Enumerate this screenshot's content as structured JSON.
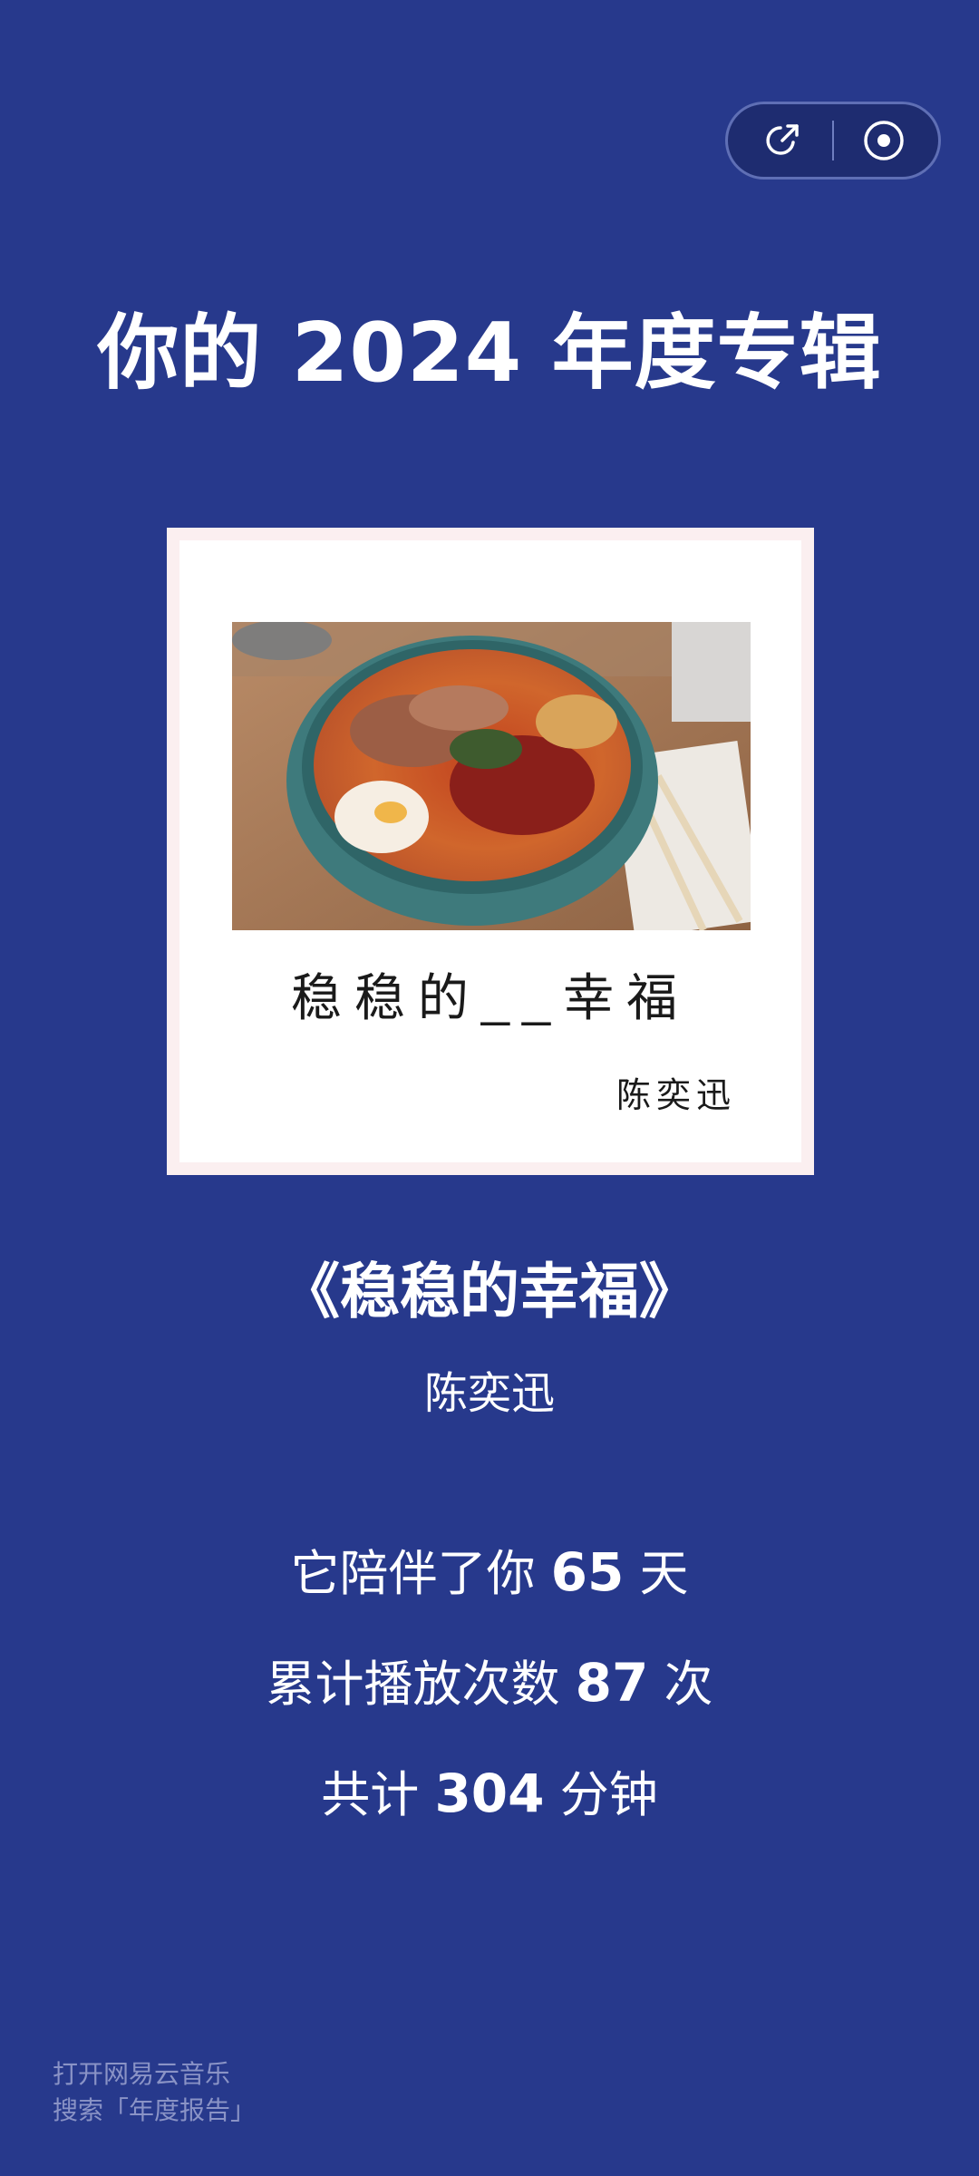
{
  "header": {
    "title": "你的 2024 年度专辑"
  },
  "capsule": {
    "share_icon": "share-icon",
    "record_icon": "target-circle-icon"
  },
  "album_cover": {
    "image_description_icon": "ramen-photo",
    "cover_song_title": "稳稳的__幸福",
    "cover_artist": "陈奕迅"
  },
  "song": {
    "title": "《稳稳的幸福》",
    "artist": "陈奕迅"
  },
  "stats": {
    "days_prefix": "它陪伴了你 ",
    "days_value": "65",
    "days_suffix": " 天",
    "plays_prefix": "累计播放次数 ",
    "plays_value": "87",
    "plays_suffix": " 次",
    "minutes_prefix": "共计 ",
    "minutes_value": "304",
    "minutes_suffix": " 分钟"
  },
  "footer": {
    "line1": "打开网易云音乐",
    "line2": "搜索「年度报告」"
  },
  "colors": {
    "background": "#27398C",
    "capsule_bg": "#1E2C70",
    "card_border": "#FBEFF0",
    "footer_text": "#8A93C6"
  }
}
